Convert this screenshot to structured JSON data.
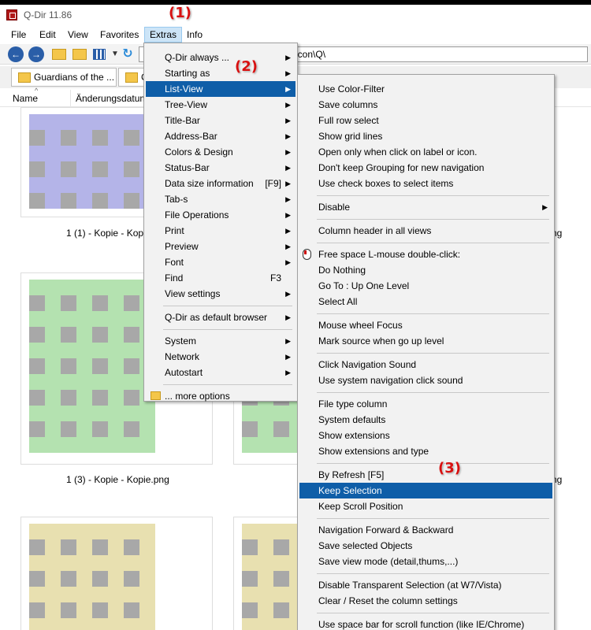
{
  "window": {
    "title": "Q-Dir 11.86"
  },
  "menubar": [
    "File",
    "Edit",
    "View",
    "Favorites",
    "Extras",
    "Info"
  ],
  "toolbar": {
    "address": "g\\icon\\Q\\"
  },
  "tabs": [
    "Guardians of the ...",
    "C"
  ],
  "columns": {
    "name": "Name",
    "date": "Änderungsdatum"
  },
  "files": [
    {
      "caption": "1 (1) - Kopie - Kopi",
      "color": "#b4b4e8"
    },
    {
      "caption": "ng",
      "color": "#b4b4e8"
    },
    {
      "caption": "1 (3) - Kopie - Kopie.png",
      "color": "#b4e2b0"
    },
    {
      "caption": "ng",
      "color": "#b4e2b0"
    },
    {
      "caption": "",
      "color": "#e8e0b0"
    },
    {
      "caption": "",
      "color": "#e8e0b0"
    }
  ],
  "extras_menu": {
    "items": [
      {
        "label": "Q-Dir always ...",
        "arrow": true
      },
      {
        "label": "Starting as",
        "arrow": true
      },
      {
        "label": "List-View",
        "arrow": true,
        "highlight": true
      },
      {
        "label": "Tree-View",
        "arrow": true
      },
      {
        "label": "Title-Bar",
        "arrow": true
      },
      {
        "label": "Address-Bar",
        "arrow": true
      },
      {
        "label": "Colors & Design",
        "arrow": true
      },
      {
        "label": "Status-Bar",
        "arrow": true
      },
      {
        "label": "Data size information",
        "shortcut": "[F9]",
        "arrow": true
      },
      {
        "label": "Tab-s",
        "arrow": true
      },
      {
        "label": "File Operations",
        "arrow": true
      },
      {
        "label": "Print",
        "arrow": true
      },
      {
        "label": "Preview",
        "arrow": true
      },
      {
        "label": "Font",
        "arrow": true
      },
      {
        "label": "Find",
        "shortcut": "F3"
      },
      {
        "label": "View settings",
        "arrow": true
      },
      {
        "separator": true
      },
      {
        "label": "Q-Dir as default browser",
        "arrow": true
      },
      {
        "separator": true
      },
      {
        "label": "System",
        "arrow": true
      },
      {
        "label": "Network",
        "arrow": true
      },
      {
        "label": "Autostart",
        "arrow": true
      },
      {
        "separator": true
      },
      {
        "label": "... more options",
        "folder": true
      }
    ]
  },
  "listview_menu": {
    "items": [
      {
        "label": "Use Color-Filter"
      },
      {
        "label": "Save columns"
      },
      {
        "label": "Full row select"
      },
      {
        "label": "Show grid lines"
      },
      {
        "label": "Open only when click on label or icon."
      },
      {
        "label": "Don't keep Grouping for new navigation"
      },
      {
        "label": "Use check boxes to select items"
      },
      {
        "separator": true
      },
      {
        "label": "Disable",
        "arrow": true
      },
      {
        "separator": true
      },
      {
        "label": "Column header in all views"
      },
      {
        "separator": true
      },
      {
        "label": "Free space L-mouse double-click:",
        "mouse": true
      },
      {
        "label": "Do Nothing"
      },
      {
        "label": "Go To : Up One Level"
      },
      {
        "label": "Select All"
      },
      {
        "separator": true
      },
      {
        "label": "Mouse wheel Focus"
      },
      {
        "label": "Mark source when go up level"
      },
      {
        "separator": true
      },
      {
        "label": "Click Navigation Sound"
      },
      {
        "label": "Use system navigation click sound"
      },
      {
        "separator": true
      },
      {
        "label": "File type column"
      },
      {
        "label": "System defaults"
      },
      {
        "label": "Show extensions"
      },
      {
        "label": "Show extensions and type"
      },
      {
        "separator": true
      },
      {
        "label": "By Refresh [F5]"
      },
      {
        "label": "Keep Selection",
        "highlight": true
      },
      {
        "label": "Keep Scroll Position"
      },
      {
        "separator": true
      },
      {
        "label": "Navigation Forward & Backward"
      },
      {
        "label": "Save selected Objects"
      },
      {
        "label": "Save view mode (detail,thums,...)"
      },
      {
        "separator": true
      },
      {
        "label": "Disable Transparent Selection (at W7/Vista)"
      },
      {
        "label": "Clear / Reset the column settings"
      },
      {
        "separator": true
      },
      {
        "label": "Use space bar for scroll function (like IE/Chrome)"
      }
    ]
  },
  "annotations": [
    "(1)",
    "(2)",
    "(3)"
  ],
  "colors": {
    "highlight": "#0f5ea8",
    "annotation": "#d81010"
  }
}
